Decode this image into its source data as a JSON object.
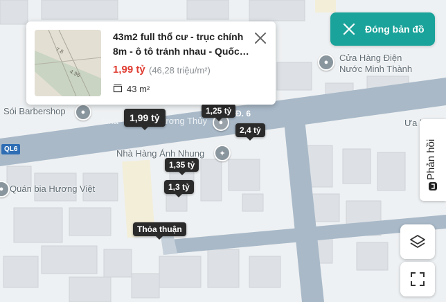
{
  "listing": {
    "title": "43m2 full thổ cư - trục chính 8m - ô tô tránh nhau - Quốc…",
    "price": "1,99 tỷ",
    "unit_price": "(46,28 triệu/m²)",
    "area": "43 m²"
  },
  "controls": {
    "close_map": "Đóng bản đồ",
    "feedback": "Phản hồi"
  },
  "poi": {
    "store": "Cửa Hàng Điện Nước Minh Thành",
    "store_line1": "Cửa Hàng Điện",
    "store_line2": "Nước Minh Thành",
    "barbershop": "Sói Barbershop",
    "restaurant": "Nhà Hàng Ánh Nhung",
    "beer": "Quán bia Hương Việt",
    "nha_partial": "Nhà",
    "thuy_partial": "ương Thủy",
    "ua_partial": "Ưa h"
  },
  "roads": {
    "d6": "Đ. 6",
    "ql6": "QL6"
  },
  "price_markers": [
    "1,99 tỷ",
    "1,25 tỷ",
    "2,4 tỷ",
    "1,35 tỷ",
    "1,3 tỷ",
    "Thỏa thuận"
  ],
  "colors": {
    "accent": "#1aa39a",
    "price": "#e03c31",
    "road": "#a9b9c8",
    "shield": "#2e6db4"
  }
}
